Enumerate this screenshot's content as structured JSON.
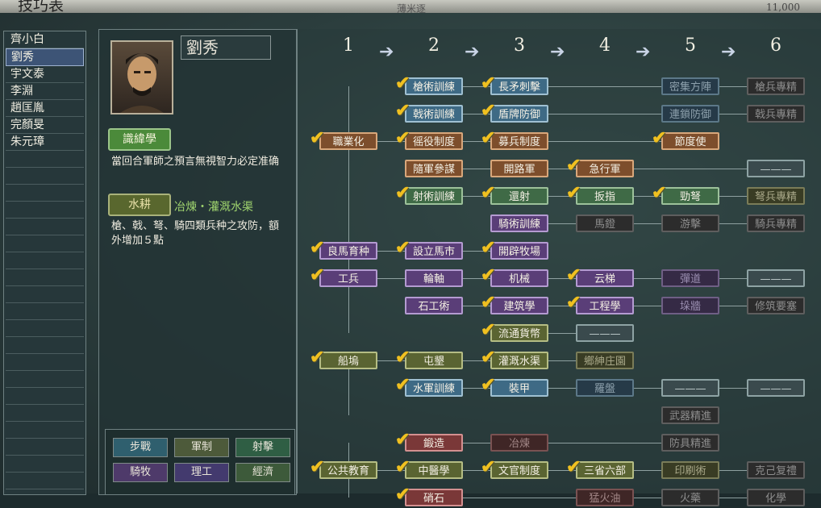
{
  "window": {
    "title": "技巧表",
    "subtitle": "薄米逐",
    "number": "11,000"
  },
  "sidebar": {
    "items": [
      {
        "label": "齊小白",
        "selected": false
      },
      {
        "label": "劉秀",
        "selected": true
      },
      {
        "label": "宇文泰",
        "selected": false
      },
      {
        "label": "李淵",
        "selected": false
      },
      {
        "label": "趙匡胤",
        "selected": false
      },
      {
        "label": "完顏旻",
        "selected": false
      },
      {
        "label": "朱元璋",
        "selected": false
      }
    ]
  },
  "officer": {
    "name": "劉秀",
    "skill1": {
      "label": "識緯學",
      "desc": "當回合軍師之預言無視智力必定准确"
    },
    "skill2": {
      "label": "水耕",
      "unlock": "冶煉・灌溉水渠",
      "desc": "槍、戟、弩、騎四類兵种之攻防，額外增加５點"
    }
  },
  "categories": [
    {
      "label": "步戰",
      "color": "#2f5f6e"
    },
    {
      "label": "軍制",
      "color": "#4d5a3a"
    },
    {
      "label": "射擊",
      "color": "#2f5e44"
    },
    {
      "label": "騎牧",
      "color": "#4e3a6a"
    },
    {
      "label": "理工",
      "color": "#433a6e"
    },
    {
      "label": "經濟",
      "color": "#3d5a3a"
    }
  ],
  "tree": {
    "columns": [
      "1",
      "2",
      "3",
      "4",
      "5",
      "6"
    ],
    "arrow": "➔",
    "rows": [
      [
        null,
        {
          "t": "槍術訓練",
          "c": "blue",
          "k": true
        },
        {
          "t": "長矛刺擊",
          "c": "blue",
          "k": true
        },
        null,
        {
          "t": "密集方陣",
          "c": "dim-blue",
          "k": false
        },
        {
          "t": "槍兵專精",
          "c": "dim-gray",
          "k": false
        }
      ],
      [
        null,
        {
          "t": "戟術訓練",
          "c": "blue",
          "k": true
        },
        {
          "t": "盾牌防御",
          "c": "blue",
          "k": true
        },
        null,
        {
          "t": "連鎖防御",
          "c": "dim-blue",
          "k": false
        },
        {
          "t": "戟兵專精",
          "c": "dim-gray",
          "k": false
        }
      ],
      [
        {
          "t": "職業化",
          "c": "orange",
          "k": true
        },
        {
          "t": "徭役制度",
          "c": "orange",
          "k": true
        },
        {
          "t": "募兵制度",
          "c": "orange",
          "k": true
        },
        null,
        {
          "t": "節度使",
          "c": "orange",
          "k": true
        },
        null
      ],
      [
        null,
        {
          "t": "隨軍參謀",
          "c": "orange",
          "k": false
        },
        {
          "t": "開路軍",
          "c": "orange",
          "k": false
        },
        {
          "t": "急行軍",
          "c": "orange",
          "k": true
        },
        null,
        {
          "t": "———",
          "c": "dim-slate",
          "k": false
        }
      ],
      [
        null,
        {
          "t": "射術訓練",
          "c": "green",
          "k": true
        },
        {
          "t": "還射",
          "c": "green",
          "k": true
        },
        {
          "t": "扳指",
          "c": "green",
          "k": true
        },
        {
          "t": "勁弩",
          "c": "green",
          "k": true
        },
        {
          "t": "弩兵專精",
          "c": "dim-olive",
          "k": false
        }
      ],
      [
        null,
        null,
        {
          "t": "騎術訓練",
          "c": "purple",
          "k": false
        },
        {
          "t": "馬鐙",
          "c": "dim-gray",
          "k": false
        },
        {
          "t": "游擊",
          "c": "dim-gray",
          "k": false
        },
        {
          "t": "騎兵專精",
          "c": "dim-gray",
          "k": false
        }
      ],
      [
        {
          "t": "良馬育种",
          "c": "purple",
          "k": true
        },
        {
          "t": "設立馬市",
          "c": "purple",
          "k": true
        },
        {
          "t": "開辟牧場",
          "c": "purple",
          "k": true
        },
        null,
        null,
        null
      ],
      [
        {
          "t": "工兵",
          "c": "purple",
          "k": true
        },
        {
          "t": "輪軸",
          "c": "purple",
          "k": false
        },
        {
          "t": "机械",
          "c": "purple",
          "k": true
        },
        {
          "t": "云梯",
          "c": "purple",
          "k": true
        },
        {
          "t": "彈道",
          "c": "dim-purple",
          "k": false
        },
        {
          "t": "———",
          "c": "dim-slate",
          "k": false
        }
      ],
      [
        null,
        {
          "t": "石工術",
          "c": "purple",
          "k": false
        },
        {
          "t": "建筑學",
          "c": "purple",
          "k": true
        },
        {
          "t": "工程學",
          "c": "purple",
          "k": true
        },
        {
          "t": "垛牆",
          "c": "dim-purple",
          "k": false
        },
        {
          "t": "修筑要塞",
          "c": "dim-gray",
          "k": false
        }
      ],
      [
        null,
        null,
        {
          "t": "流通貨幣",
          "c": "olive",
          "k": true
        },
        {
          "t": "———",
          "c": "dim-slate",
          "k": false
        },
        null,
        null
      ],
      [
        {
          "t": "船塢",
          "c": "olive",
          "k": true
        },
        {
          "t": "屯墾",
          "c": "olive",
          "k": true
        },
        {
          "t": "灌溉水渠",
          "c": "olive",
          "k": true
        },
        {
          "t": "鄉紳庄園",
          "c": "dim-olive",
          "k": false
        },
        null,
        null
      ],
      [
        null,
        {
          "t": "水軍訓練",
          "c": "blue",
          "k": true
        },
        {
          "t": "裝甲",
          "c": "blue",
          "k": true
        },
        {
          "t": "羅盤",
          "c": "dim-blue",
          "k": false
        },
        {
          "t": "———",
          "c": "dim-slate",
          "k": false
        },
        {
          "t": "———",
          "c": "dim-slate",
          "k": false
        }
      ],
      [
        null,
        null,
        null,
        null,
        {
          "t": "武器精進",
          "c": "dim-gray",
          "k": false
        },
        null
      ],
      [
        null,
        {
          "t": "鍛造",
          "c": "red",
          "k": true
        },
        {
          "t": "冶煉",
          "c": "dim-red",
          "k": false
        },
        null,
        {
          "t": "防具精進",
          "c": "dim-gray",
          "k": false
        },
        null
      ],
      [
        {
          "t": "公共教育",
          "c": "olive",
          "k": true
        },
        {
          "t": "中醫學",
          "c": "olive",
          "k": true
        },
        {
          "t": "文官制度",
          "c": "olive",
          "k": true
        },
        {
          "t": "三省六部",
          "c": "olive",
          "k": true
        },
        {
          "t": "印刷術",
          "c": "dim-olive",
          "k": false
        },
        {
          "t": "克己复禮",
          "c": "dim-gray",
          "k": false
        }
      ],
      [
        null,
        {
          "t": "硝石",
          "c": "red",
          "k": true
        },
        null,
        {
          "t": "猛火油",
          "c": "dim-red",
          "k": false
        },
        {
          "t": "火藥",
          "c": "dim-gray",
          "k": false
        },
        {
          "t": "化學",
          "c": "dim-gray",
          "k": false
        }
      ]
    ]
  }
}
